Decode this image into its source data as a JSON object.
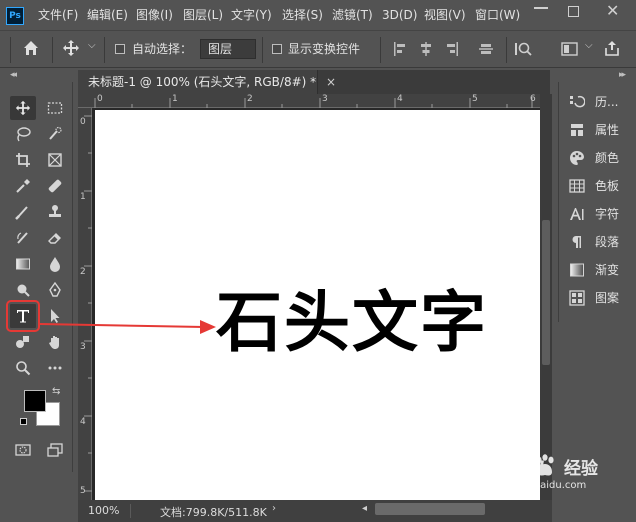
{
  "app": {
    "logo_text": "Ps"
  },
  "menu": [
    "文件(F)",
    "编辑(E)",
    "图像(I)",
    "图层(L)",
    "文字(Y)",
    "选择(S)",
    "滤镜(T)",
    "3D(D)",
    "视图(V)",
    "窗口(W)"
  ],
  "options": {
    "auto_select_label": "自动选择：",
    "layer_dropdown": "图层",
    "show_transform_label": "显示变换控件"
  },
  "document": {
    "tab_title": "未标题-1 @ 100% (石头文字, RGB/8#) *",
    "close_glyph": "×",
    "canvas_text": "石头文字",
    "ruler_h": [
      "0",
      "1",
      "2",
      "3",
      "4",
      "5",
      "6"
    ],
    "ruler_v": [
      "0",
      "1",
      "2",
      "3",
      "4",
      "5"
    ]
  },
  "status": {
    "zoom": "100%",
    "doc_info": "文档:799.8K/511.8K"
  },
  "panels": [
    {
      "icon": "history-icon",
      "label": "历..."
    },
    {
      "icon": "properties-icon",
      "label": "属性"
    },
    {
      "icon": "color-icon",
      "label": "颜色"
    },
    {
      "icon": "swatches-icon",
      "label": "色板"
    },
    {
      "icon": "character-icon",
      "label": "字符"
    },
    {
      "icon": "paragraph-icon",
      "label": "段落"
    },
    {
      "icon": "gradient-icon",
      "label": "渐变"
    },
    {
      "icon": "patterns-icon",
      "label": "图案"
    }
  ],
  "watermark": {
    "brand": "Baidu",
    "suffix": "经验",
    "url": "jingyan.baidu.com"
  },
  "colors": {
    "foreground": "#000000",
    "background": "#ffffff",
    "highlight": "#e53935",
    "accent": "#31a8ff"
  }
}
